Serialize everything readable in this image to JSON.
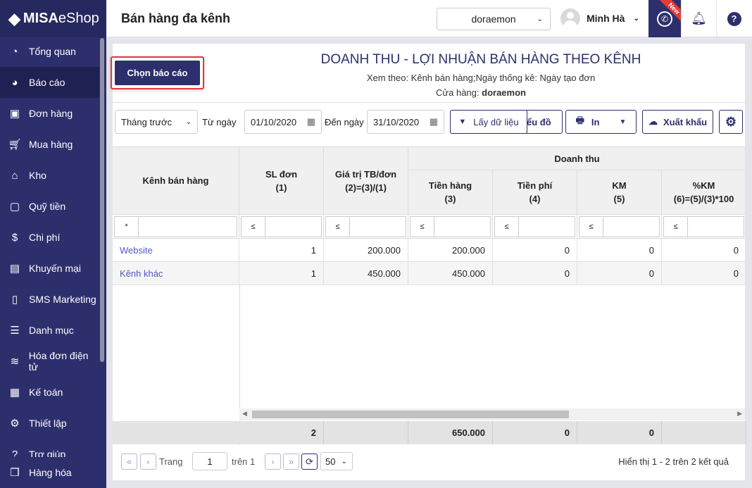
{
  "sidebar": {
    "brand_bold": "MISA",
    "brand_light": "eShop",
    "items": [
      {
        "label": "Tổng quan",
        "icon": "dashboard-icon"
      },
      {
        "label": "Báo cáo",
        "icon": "pie-chart-icon"
      },
      {
        "label": "Đơn hàng",
        "icon": "order-icon"
      },
      {
        "label": "Mua hàng",
        "icon": "cart-icon"
      },
      {
        "label": "Kho",
        "icon": "warehouse-icon"
      },
      {
        "label": "Quỹ tiền",
        "icon": "safe-icon"
      },
      {
        "label": "Chi phí",
        "icon": "money-bag-icon"
      },
      {
        "label": "Khuyến mại",
        "icon": "gift-icon"
      },
      {
        "label": "SMS Marketing",
        "icon": "phone-icon"
      },
      {
        "label": "Danh mục",
        "icon": "list-icon"
      },
      {
        "label": "Hóa đơn điện tử",
        "icon": "invoice-icon"
      },
      {
        "label": "Kế toán",
        "icon": "calculator-icon"
      },
      {
        "label": "Thiết lập",
        "icon": "gear-icon"
      },
      {
        "label": "Trợ giúp",
        "icon": "help-icon"
      },
      {
        "label": "Hàng hóa",
        "icon": "boxes-icon"
      }
    ]
  },
  "header": {
    "title": "Bán hàng đa kênh",
    "store": "doraemon",
    "user": "Minh Hà",
    "new_badge": "New"
  },
  "report": {
    "choose_label": "Chọn báo cáo",
    "title": "DOANH THU - LỢI NHUẬN BÁN HÀNG THEO KÊNH",
    "view_by": "Xem theo: Kênh bán hàng;Ngày thống kê: Ngày tạo đơn",
    "store_label": "Cửa hàng:",
    "store_value": "doraemon"
  },
  "toolbar": {
    "period": "Tháng trước",
    "from_label": "Từ ngày",
    "from": "01/10/2020",
    "to_label": "Đến ngày",
    "to": "31/10/2020",
    "fetch": "Lấy dữ liệu",
    "chart": "ểu đồ",
    "print": "In",
    "export": "Xuất khẩu"
  },
  "table": {
    "group_header": "Doanh thu",
    "columns": [
      {
        "l1": "Kênh bán hàng",
        "l2": "",
        "op": "*"
      },
      {
        "l1": "SL đơn",
        "l2": "(1)",
        "op": "≤"
      },
      {
        "l1": "Giá trị TB/đơn",
        "l2": "(2)=(3)/(1)",
        "op": "≤"
      },
      {
        "l1": "Tiền hàng",
        "l2": "(3)",
        "op": "≤"
      },
      {
        "l1": "Tiền phí",
        "l2": "(4)",
        "op": "≤"
      },
      {
        "l1": "KM",
        "l2": "(5)",
        "op": "≤"
      },
      {
        "l1": "%KM",
        "l2": "(6)=(5)/(3)*100",
        "op": "≤"
      }
    ],
    "rows": [
      [
        "Website",
        "1",
        "200.000",
        "200.000",
        "0",
        "0",
        "0"
      ],
      [
        "Kênh khác",
        "1",
        "450.000",
        "450.000",
        "0",
        "0",
        "0"
      ]
    ],
    "totals": [
      "",
      "2",
      "",
      "650.000",
      "0",
      "0",
      ""
    ]
  },
  "pager": {
    "page_label": "Trang",
    "page": "1",
    "of": "trên 1",
    "size": "50",
    "summary": "Hiển thị 1 - 2 trên 2 kết quả"
  }
}
